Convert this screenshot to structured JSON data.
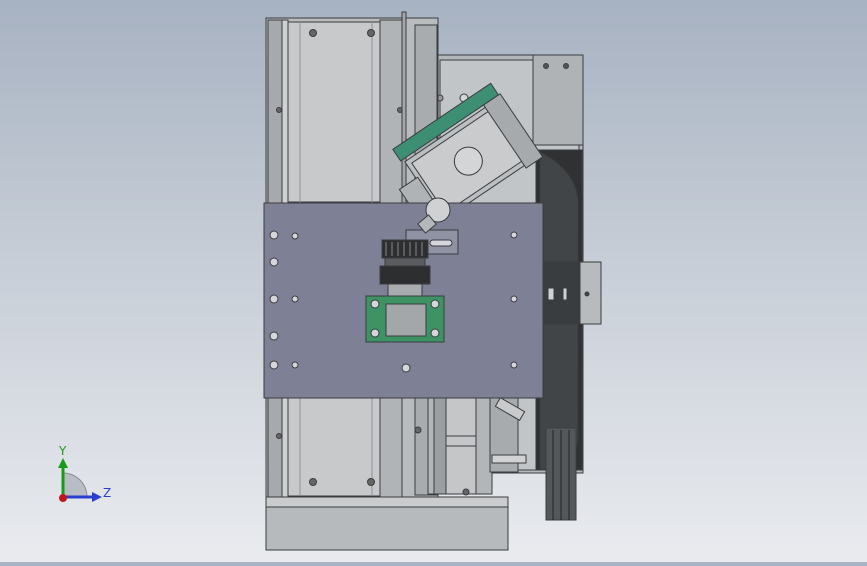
{
  "triad": {
    "y_label": "Y",
    "z_label": "Z",
    "colors": {
      "y": "#1a9a1a",
      "z": "#2a3fd0",
      "x": "#c01818"
    }
  },
  "model": {
    "colors": {
      "frame": "#b9bcbf",
      "frame_dark": "#8e9296",
      "plate": "#7e8196",
      "motor_green": "#3c8f72",
      "bracket_green": "#3d9363",
      "lens_dark": "#2c2e30",
      "outline": "#3a3c3f"
    }
  }
}
